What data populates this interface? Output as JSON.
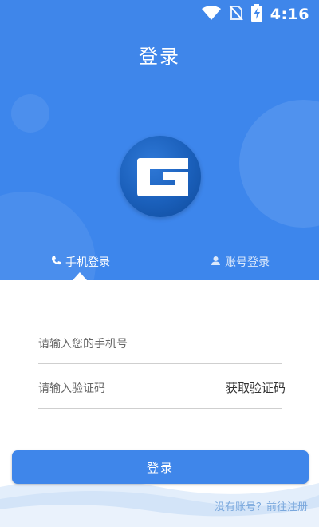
{
  "status_bar": {
    "time": "4:16",
    "icons": [
      "wifi-icon",
      "no-sim-icon",
      "battery-charging-icon"
    ]
  },
  "header": {
    "title": "登录"
  },
  "logo": {
    "letter": "G"
  },
  "tabs": [
    {
      "label": "手机登录",
      "icon": "phone-icon",
      "active": true
    },
    {
      "label": "账号登录",
      "icon": "user-icon",
      "active": false
    }
  ],
  "form": {
    "phone_placeholder": "请输入您的手机号",
    "code_placeholder": "请输入验证码",
    "get_code_label": "获取验证码"
  },
  "login_button": {
    "label": "登录"
  },
  "register_link": "没有账号？前往注册",
  "colors": {
    "primary": "#3f86ea",
    "logo": "#1a5fba",
    "link": "#7aa8dd"
  }
}
